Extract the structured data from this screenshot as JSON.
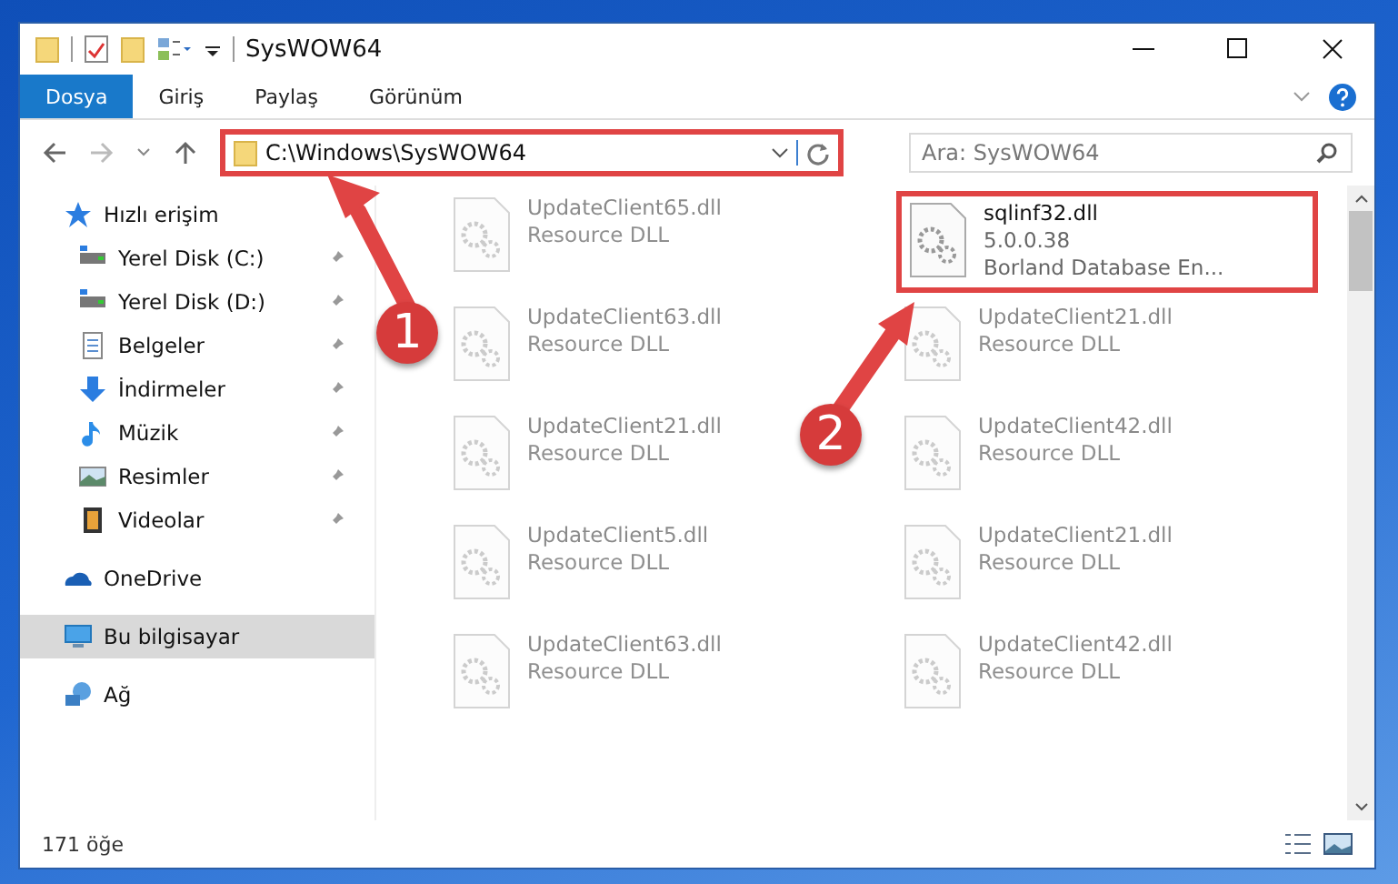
{
  "window": {
    "title": "SysWOW64"
  },
  "ribbon": {
    "tabs": [
      {
        "label": "Dosya",
        "selected": true
      },
      {
        "label": "Giriş",
        "selected": false
      },
      {
        "label": "Paylaş",
        "selected": false
      },
      {
        "label": "Görünüm",
        "selected": false
      }
    ]
  },
  "address_bar": {
    "path": "C:\\Windows\\SysWOW64",
    "highlighted": true
  },
  "search": {
    "placeholder": "Ara: SysWOW64"
  },
  "sidebar": {
    "items": [
      {
        "label": "Hızlı erişim",
        "kind": "star",
        "selected": false,
        "children": [
          {
            "label": "Yerel Disk (C:)",
            "kind": "drive",
            "pinned": true
          },
          {
            "label": "Yerel Disk (D:)",
            "kind": "drive",
            "pinned": true
          },
          {
            "label": "Belgeler",
            "kind": "docs",
            "pinned": true
          },
          {
            "label": "İndirmeler",
            "kind": "download",
            "pinned": true
          },
          {
            "label": "Müzik",
            "kind": "music",
            "pinned": true
          },
          {
            "label": "Resimler",
            "kind": "pictures",
            "pinned": true
          },
          {
            "label": "Videolar",
            "kind": "videos",
            "pinned": true
          }
        ]
      },
      {
        "label": "OneDrive",
        "kind": "cloud",
        "selected": false
      },
      {
        "label": "Bu bilgisayar",
        "kind": "computer",
        "selected": true
      },
      {
        "label": "Ağ",
        "kind": "network",
        "selected": false
      }
    ]
  },
  "files": [
    {
      "name": "UpdateClient65.dll",
      "lines": [
        "Resource DLL"
      ],
      "blurred": true,
      "highlighted": false
    },
    {
      "name": "sqlinf32.dll",
      "lines": [
        "5.0.0.38",
        "Borland Database En..."
      ],
      "blurred": false,
      "highlighted": true
    },
    {
      "name": "UpdateClient63.dll",
      "lines": [
        "Resource DLL"
      ],
      "blurred": true,
      "highlighted": false
    },
    {
      "name": "UpdateClient21.dll",
      "lines": [
        "Resource DLL"
      ],
      "blurred": true,
      "highlighted": false
    },
    {
      "name": "UpdateClient21.dll",
      "lines": [
        "Resource DLL"
      ],
      "blurred": true,
      "highlighted": false
    },
    {
      "name": "UpdateClient42.dll",
      "lines": [
        "Resource DLL"
      ],
      "blurred": true,
      "highlighted": false
    },
    {
      "name": "UpdateClient5.dll",
      "lines": [
        "Resource DLL"
      ],
      "blurred": true,
      "highlighted": false
    },
    {
      "name": "UpdateClient21.dll",
      "lines": [
        "Resource DLL"
      ],
      "blurred": true,
      "highlighted": false
    },
    {
      "name": "UpdateClient63.dll",
      "lines": [
        "Resource DLL"
      ],
      "blurred": true,
      "highlighted": false
    },
    {
      "name": "UpdateClient42.dll",
      "lines": [
        "Resource DLL"
      ],
      "blurred": true,
      "highlighted": false
    }
  ],
  "status_bar": {
    "count": "171 öğe"
  },
  "callouts": [
    {
      "number": "1"
    },
    {
      "number": "2"
    }
  ]
}
